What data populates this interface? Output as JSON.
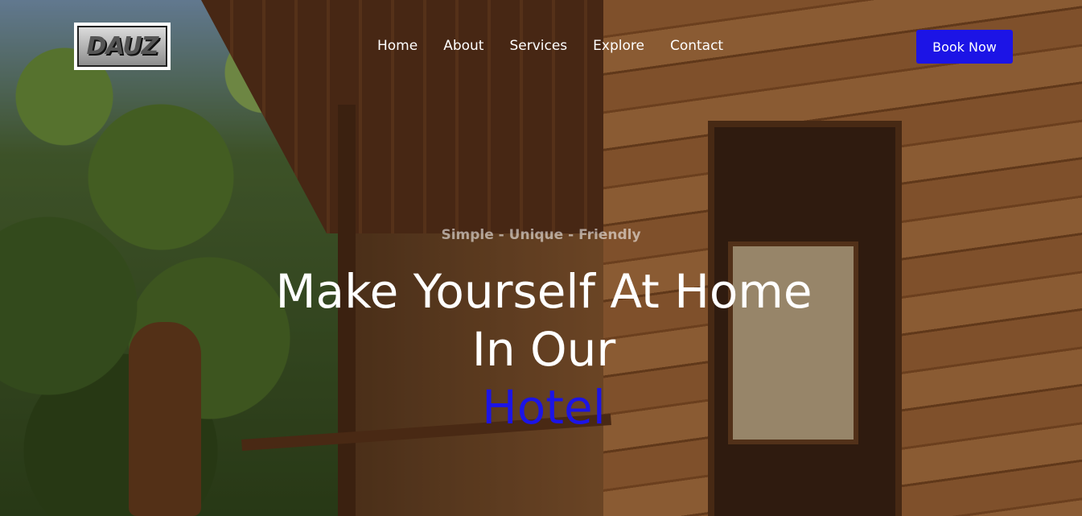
{
  "header": {
    "logo_text": "DAUZ",
    "nav": [
      {
        "label": "Home"
      },
      {
        "label": "About"
      },
      {
        "label": "Services"
      },
      {
        "label": "Explore"
      },
      {
        "label": "Contact"
      }
    ],
    "cta_label": "Book Now"
  },
  "hero": {
    "tagline": "Simple - Unique - Friendly",
    "headline_line1": "Make Yourself At Home",
    "headline_line2": "In Our",
    "headline_accent": "Hotel"
  },
  "colors": {
    "accent": "#1c14e6",
    "text": "#ffffff"
  }
}
